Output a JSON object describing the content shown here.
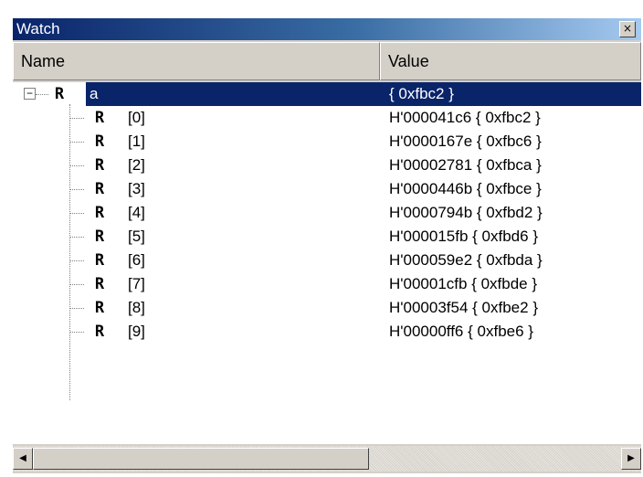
{
  "window": {
    "title": "Watch",
    "close_glyph": "×"
  },
  "columns": {
    "name": "Name",
    "value": "Value"
  },
  "root": {
    "expander": "−",
    "icon": "R",
    "name": "a",
    "value": "{ 0xfbc2 }"
  },
  "rows": [
    {
      "icon": "R",
      "name": "[0]",
      "value": "H'000041c6 { 0xfbc2 }"
    },
    {
      "icon": "R",
      "name": "[1]",
      "value": "H'0000167e { 0xfbc6 }"
    },
    {
      "icon": "R",
      "name": "[2]",
      "value": "H'00002781 { 0xfbca }"
    },
    {
      "icon": "R",
      "name": "[3]",
      "value": "H'0000446b { 0xfbce }"
    },
    {
      "icon": "R",
      "name": "[4]",
      "value": "H'0000794b { 0xfbd2 }"
    },
    {
      "icon": "R",
      "name": "[5]",
      "value": "H'000015fb { 0xfbd6 }"
    },
    {
      "icon": "R",
      "name": "[6]",
      "value": "H'000059e2 { 0xfbda }"
    },
    {
      "icon": "R",
      "name": "[7]",
      "value": "H'00001cfb { 0xfbde }"
    },
    {
      "icon": "R",
      "name": "[8]",
      "value": "H'00003f54 { 0xfbe2 }"
    },
    {
      "icon": "R",
      "name": "[9]",
      "value": "H'00000ff6 { 0xfbe6 }"
    }
  ],
  "scrollbar": {
    "left_glyph": "◀",
    "right_glyph": "▶"
  },
  "colors": {
    "selection": "#0a246a",
    "face": "#d4d0c8"
  }
}
